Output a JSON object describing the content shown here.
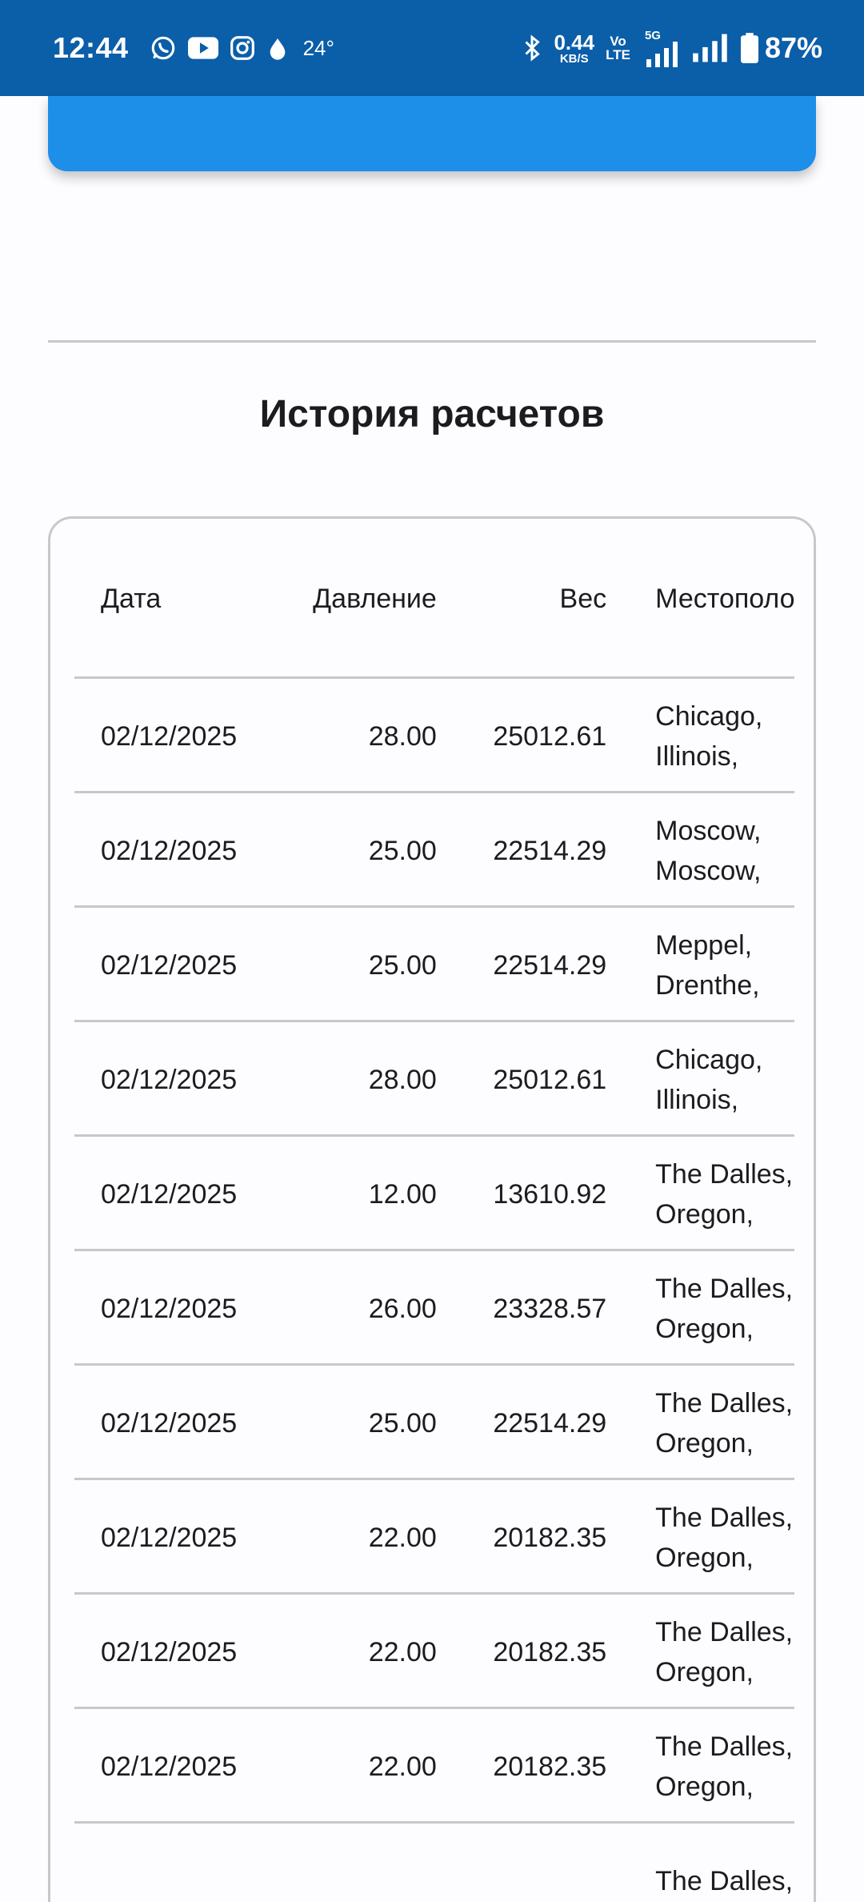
{
  "status_bar": {
    "time": "12:44",
    "temperature": "24°",
    "net_speed_value": "0.44",
    "net_speed_unit": "KB/S",
    "volte_top": "Vo",
    "volte_bottom": "LTE",
    "network": "5G",
    "battery": "87%",
    "icons": [
      "whatsapp-icon",
      "youtube-icon",
      "instagram-icon",
      "drop-icon",
      "bluetooth-icon",
      "signal-icon",
      "signal-icon",
      "battery-icon"
    ]
  },
  "section_title": "История расчетов",
  "table": {
    "headers": {
      "date": "Дата",
      "pressure": "Давление",
      "weight": "Вес",
      "location": "Местополо"
    },
    "rows": [
      {
        "date": "02/12/2025",
        "pressure": "28.00",
        "weight": "25012.61",
        "loc1": "Chicago,",
        "loc2": "Illinois,"
      },
      {
        "date": "02/12/2025",
        "pressure": "25.00",
        "weight": "22514.29",
        "loc1": "Moscow,",
        "loc2": "Moscow,"
      },
      {
        "date": "02/12/2025",
        "pressure": "25.00",
        "weight": "22514.29",
        "loc1": "Meppel,",
        "loc2": "Drenthe,"
      },
      {
        "date": "02/12/2025",
        "pressure": "28.00",
        "weight": "25012.61",
        "loc1": "Chicago,",
        "loc2": "Illinois,"
      },
      {
        "date": "02/12/2025",
        "pressure": "12.00",
        "weight": "13610.92",
        "loc1": "The Dalles,",
        "loc2": "Oregon,"
      },
      {
        "date": "02/12/2025",
        "pressure": "26.00",
        "weight": "23328.57",
        "loc1": "The Dalles,",
        "loc2": "Oregon,"
      },
      {
        "date": "02/12/2025",
        "pressure": "25.00",
        "weight": "22514.29",
        "loc1": "The Dalles,",
        "loc2": "Oregon,"
      },
      {
        "date": "02/12/2025",
        "pressure": "22.00",
        "weight": "20182.35",
        "loc1": "The Dalles,",
        "loc2": "Oregon,"
      },
      {
        "date": "02/12/2025",
        "pressure": "22.00",
        "weight": "20182.35",
        "loc1": "The Dalles,",
        "loc2": "Oregon,"
      },
      {
        "date": "02/12/2025",
        "pressure": "22.00",
        "weight": "20182.35",
        "loc1": "The Dalles,",
        "loc2": "Oregon,"
      },
      {
        "date": "",
        "pressure": "",
        "weight": "",
        "loc1": "The Dalles,",
        "loc2": ""
      }
    ]
  },
  "colors": {
    "status_bar": "#0b5ea8",
    "accent_button": "#1e8fe8",
    "divider": "#c9c7cc"
  }
}
